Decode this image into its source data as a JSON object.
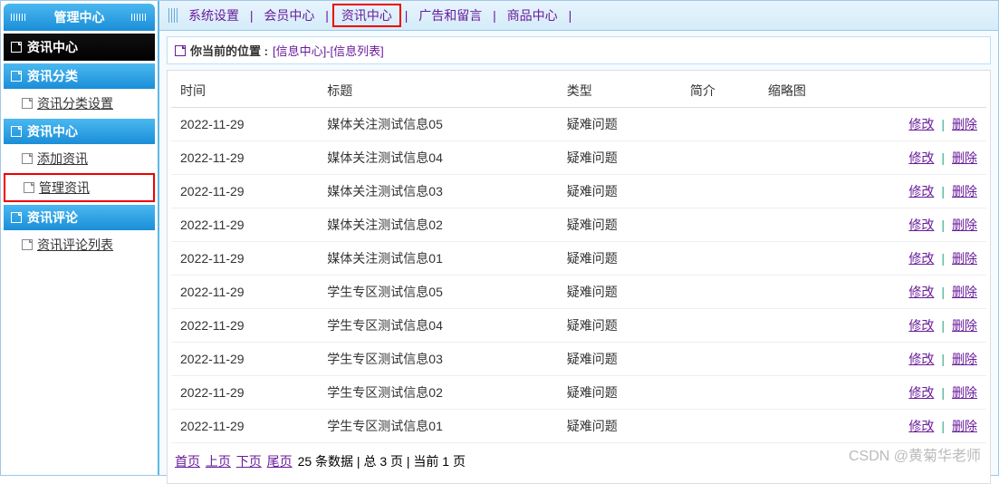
{
  "sidebar": {
    "header": "管理中心",
    "group": "资讯中心",
    "cats": [
      {
        "title": "资讯分类",
        "items": [
          {
            "label": "资讯分类设置",
            "highlight": false
          }
        ]
      },
      {
        "title": "资讯中心",
        "items": [
          {
            "label": "添加资讯",
            "highlight": false
          },
          {
            "label": "管理资讯",
            "highlight": true
          }
        ]
      },
      {
        "title": "资讯评论",
        "items": [
          {
            "label": "资讯评论列表",
            "highlight": false
          }
        ]
      }
    ]
  },
  "topnav": {
    "items": [
      {
        "label": "系统设置",
        "highlight": false
      },
      {
        "label": "会员中心",
        "highlight": false
      },
      {
        "label": "资讯中心",
        "highlight": true
      },
      {
        "label": "广告和留言",
        "highlight": false
      },
      {
        "label": "商品中心",
        "highlight": false
      }
    ]
  },
  "breadcrumb": {
    "prefix": "你当前的位置 :",
    "path": "[信息中心]-[信息列表]"
  },
  "table": {
    "headers": {
      "time": "时间",
      "title": "标题",
      "type": "类型",
      "intro": "简介",
      "thumb": "缩略图"
    },
    "action_edit": "修改",
    "action_delete": "删除",
    "rows": [
      {
        "time": "2022-11-29",
        "title": "媒体关注测试信息05",
        "type": "疑难问题",
        "intro": "",
        "thumb": ""
      },
      {
        "time": "2022-11-29",
        "title": "媒体关注测试信息04",
        "type": "疑难问题",
        "intro": "",
        "thumb": ""
      },
      {
        "time": "2022-11-29",
        "title": "媒体关注测试信息03",
        "type": "疑难问题",
        "intro": "",
        "thumb": ""
      },
      {
        "time": "2022-11-29",
        "title": "媒体关注测试信息02",
        "type": "疑难问题",
        "intro": "",
        "thumb": ""
      },
      {
        "time": "2022-11-29",
        "title": "媒体关注测试信息01",
        "type": "疑难问题",
        "intro": "",
        "thumb": ""
      },
      {
        "time": "2022-11-29",
        "title": "学生专区测试信息05",
        "type": "疑难问题",
        "intro": "",
        "thumb": ""
      },
      {
        "time": "2022-11-29",
        "title": "学生专区测试信息04",
        "type": "疑难问题",
        "intro": "",
        "thumb": ""
      },
      {
        "time": "2022-11-29",
        "title": "学生专区测试信息03",
        "type": "疑难问题",
        "intro": "",
        "thumb": ""
      },
      {
        "time": "2022-11-29",
        "title": "学生专区测试信息02",
        "type": "疑难问题",
        "intro": "",
        "thumb": ""
      },
      {
        "time": "2022-11-29",
        "title": "学生专区测试信息01",
        "type": "疑难问题",
        "intro": "",
        "thumb": ""
      }
    ]
  },
  "pager": {
    "first": "首页",
    "prev": "上页",
    "next": "下页",
    "last": "尾页",
    "summary": "25 条数据 | 总 3 页 | 当前 1 页"
  },
  "watermark": "CSDN @黄菊华老师"
}
